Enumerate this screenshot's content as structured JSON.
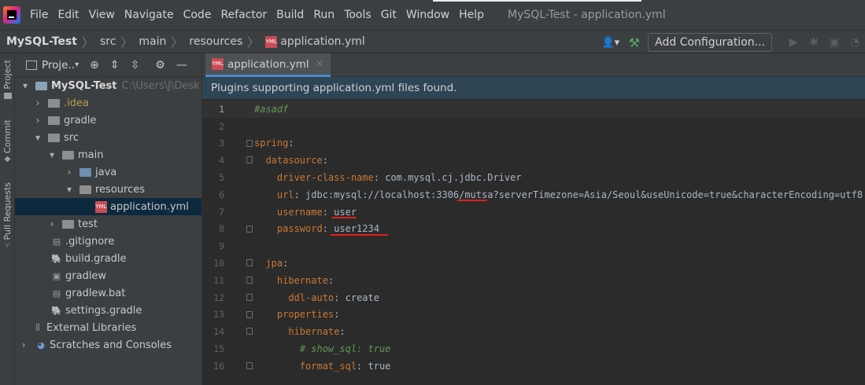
{
  "menubar": {
    "items": [
      "File",
      "Edit",
      "View",
      "Navigate",
      "Code",
      "Refactor",
      "Build",
      "Run",
      "Tools",
      "Git",
      "Window",
      "Help"
    ],
    "window_title": "MySQL-Test - application.yml"
  },
  "navbar": {
    "crumbs": [
      "MySQL-Test",
      "src",
      "main",
      "resources",
      "application.yml"
    ],
    "add_config_label": "Add Configuration..."
  },
  "left_strip": {
    "tabs": [
      "Project",
      "Commit",
      "Pull Requests"
    ]
  },
  "project_panel": {
    "title": "Proje..",
    "tree": [
      {
        "label": "MySQL-Test",
        "extra": "C:\\Users\\J\\Desk",
        "arrow": "▾"
      },
      {
        "label": ".idea",
        "arrow": "›"
      },
      {
        "label": "gradle",
        "arrow": "›"
      },
      {
        "label": "src",
        "arrow": "▾"
      },
      {
        "label": "main",
        "arrow": "▾"
      },
      {
        "label": "java",
        "arrow": "›"
      },
      {
        "label": "resources",
        "arrow": "▾"
      },
      {
        "label": "application.yml",
        "arrow": ""
      },
      {
        "label": "test",
        "arrow": "›"
      },
      {
        "label": ".gitignore",
        "arrow": ""
      },
      {
        "label": "build.gradle",
        "arrow": ""
      },
      {
        "label": "gradlew",
        "arrow": ""
      },
      {
        "label": "gradlew.bat",
        "arrow": ""
      },
      {
        "label": "settings.gradle",
        "arrow": ""
      },
      {
        "label": "External Libraries",
        "arrow": ""
      },
      {
        "label": "Scratches and Consoles",
        "arrow": "›"
      }
    ]
  },
  "editor": {
    "tab_label": "application.yml",
    "notice": "Plugins supporting application.yml files found.",
    "lines": [
      {
        "n": "1",
        "comment": "#asadf"
      },
      {
        "n": "2"
      },
      {
        "n": "3",
        "key": "spring",
        "indent": ""
      },
      {
        "n": "4",
        "key": "datasource",
        "indent": "  "
      },
      {
        "n": "5",
        "key": "driver-class-name",
        "value": "com.mysql.cj.jdbc.Driver",
        "indent": "    "
      },
      {
        "n": "6",
        "key": "url",
        "value": "jdbc:mysql://localhost:3306/mutsa?serverTimezone=Asia/Seoul&useUnicode=true&characterEncoding=utf8",
        "indent": "    "
      },
      {
        "n": "7",
        "key": "username",
        "value": "user",
        "indent": "    "
      },
      {
        "n": "8",
        "key": "password",
        "value": "user1234",
        "indent": "    "
      },
      {
        "n": "9"
      },
      {
        "n": "10",
        "key": "jpa",
        "indent": "  "
      },
      {
        "n": "11",
        "key": "hibernate",
        "indent": "    "
      },
      {
        "n": "12",
        "key": "ddl-auto",
        "value": "create",
        "indent": "      "
      },
      {
        "n": "13",
        "key": "properties",
        "indent": "    "
      },
      {
        "n": "14",
        "key": "hibernate",
        "indent": "      "
      },
      {
        "n": "15",
        "comment": "# show_sql: true",
        "indent": "        "
      },
      {
        "n": "16",
        "key": "format_sql",
        "value": "true",
        "indent": "        "
      }
    ]
  },
  "colors": {
    "key": "#cc7832",
    "value": "#a9b7c6",
    "comment": "#629755",
    "annotation": "#e01e1e"
  }
}
